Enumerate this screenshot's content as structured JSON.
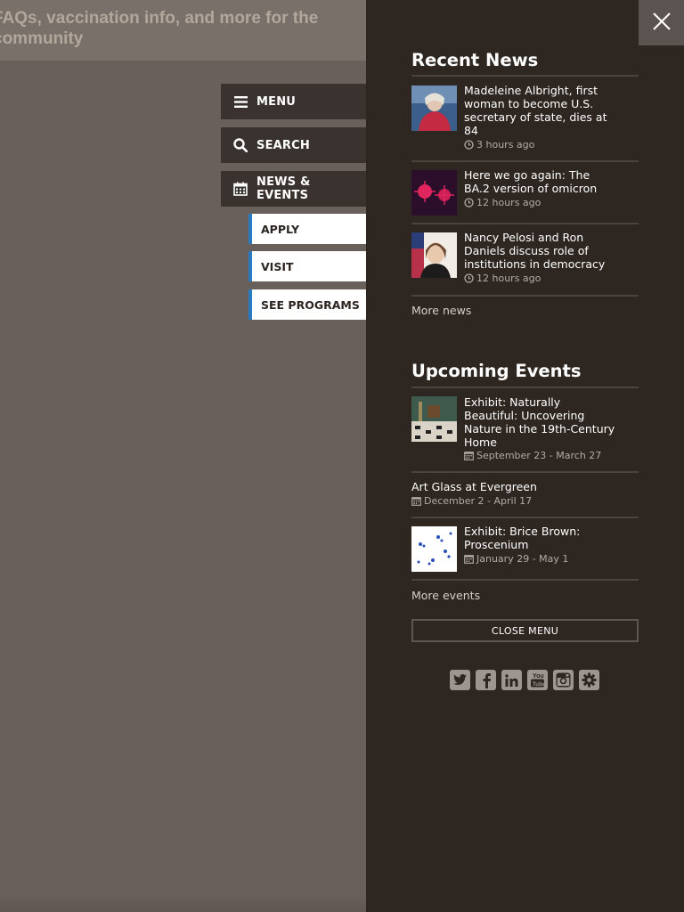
{
  "background": {
    "banner_text": "FAQs, vaccination info, and more for the community"
  },
  "nav": {
    "menu": {
      "label": "MENU",
      "icon": "hamburger-icon"
    },
    "search": {
      "label": "SEARCH",
      "icon": "search-icon"
    },
    "news_events": {
      "label": "NEWS & EVENTS",
      "icon": "calendar-icon"
    },
    "sub": [
      "APPLY",
      "VISIT",
      "SEE PROGRAMS"
    ]
  },
  "panel": {
    "close_icon": "close-icon",
    "recent_news": {
      "title": "Recent News",
      "items": [
        {
          "title": "Madeleine Albright, first woman to become U.S. secretary of state, dies at 84",
          "time": "3 hours ago"
        },
        {
          "title": "Here we go again: The BA.2 version of omicron",
          "time": "12 hours ago"
        },
        {
          "title": "Nancy Pelosi and Ron Daniels discuss role of institutions in democracy",
          "time": "12 hours ago"
        }
      ],
      "more": "More news"
    },
    "upcoming_events": {
      "title": "Upcoming Events",
      "items": [
        {
          "title": "Exhibit: Naturally Beautiful: Uncovering Nature in the 19th-Century Home",
          "date": "September 23 - March 27"
        },
        {
          "title": "Art Glass at Evergreen",
          "date": "December 2 - April 17"
        },
        {
          "title": "Exhibit: Brice Brown: Proscenium",
          "date": "January 29 - May 1"
        }
      ],
      "more": "More events"
    },
    "close_menu": "CLOSE MENU",
    "social": [
      "twitter-icon",
      "facebook-icon",
      "linkedin-icon",
      "youtube-icon",
      "instagram-icon",
      "settings-icon"
    ]
  },
  "colors": {
    "panel_bg": "#2d2621",
    "accent": "#2a7ac2",
    "overlay": "#6a605b"
  }
}
